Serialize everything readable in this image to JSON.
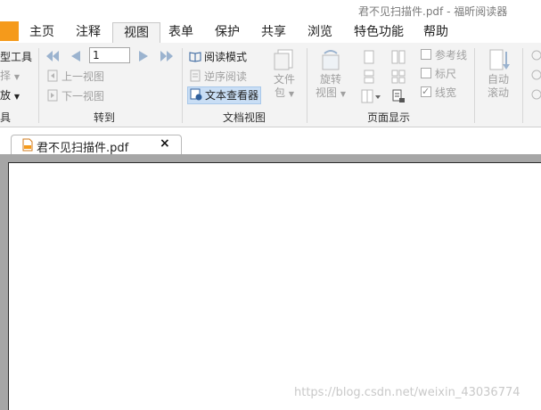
{
  "window": {
    "title": "君不见扫描件.pdf - 福昕阅读器"
  },
  "menu": {
    "tabs": [
      {
        "label": "主页"
      },
      {
        "label": "注释"
      },
      {
        "label": "视图",
        "active": true
      },
      {
        "label": "表单"
      },
      {
        "label": "保护"
      },
      {
        "label": "共享"
      },
      {
        "label": "浏览"
      },
      {
        "label": "特色功能"
      },
      {
        "label": "帮助"
      }
    ]
  },
  "ribbon": {
    "tools_group": {
      "items": [
        "型工具",
        "择",
        "放"
      ],
      "label": "具"
    },
    "goto_group": {
      "page_value": "1",
      "prev_view": "上一视图",
      "next_view": "下一视图",
      "label": "转到"
    },
    "docview_group": {
      "reading_mode": "阅读模式",
      "reverse_reading": "逆序阅读",
      "text_viewer": "文本查看器",
      "file_pack_line1": "文件",
      "file_pack_line2": "包",
      "label": "文档视图"
    },
    "pagedisplay_group": {
      "rotate_line1": "旋转",
      "rotate_line2": "视图",
      "guides": "参考线",
      "ruler": "标尺",
      "line_weights": "线宽",
      "label": "页面显示"
    },
    "autoscroll": {
      "line1": "自动",
      "line2": "滚动"
    }
  },
  "document_tab": {
    "name": "君不见扫描件.pdf",
    "close": "×"
  },
  "watermark": "https://blog.csdn.net/weixin_43036774",
  "colors": {
    "accent": "#f59a1b",
    "doc_background": "#a6a6a6"
  }
}
